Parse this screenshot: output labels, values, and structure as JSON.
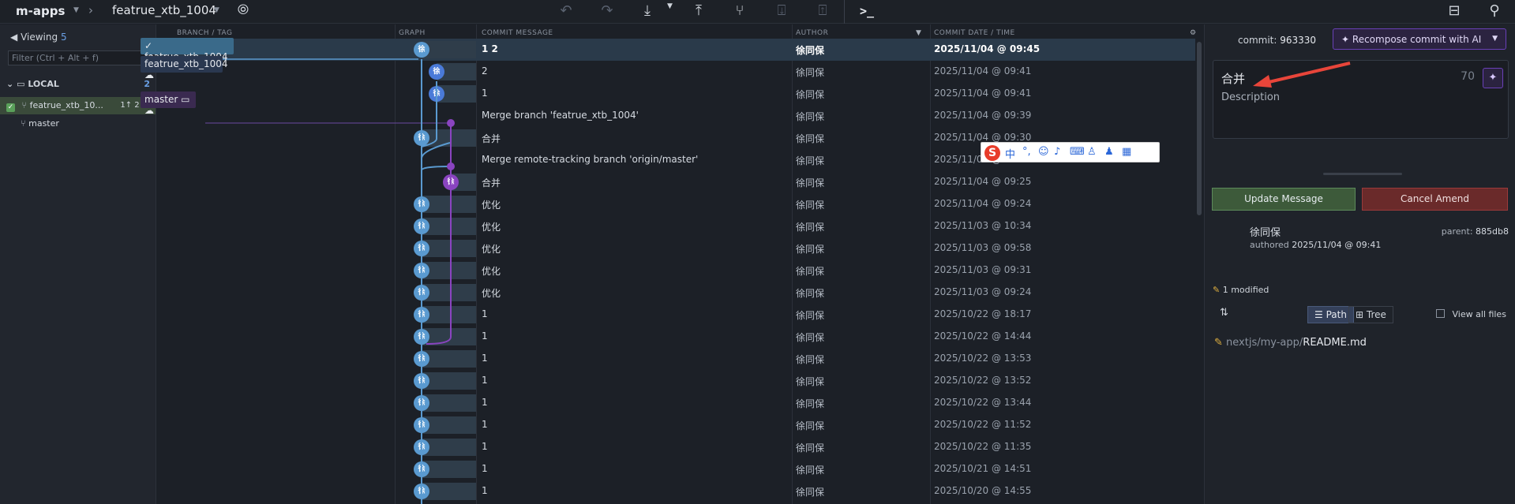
{
  "topbar": {
    "repo": "m-apps",
    "branch": "featrue_xtb_1004",
    "icons": [
      "lightning-icon",
      "undo-icon",
      "redo-icon",
      "pull-icon",
      "push-icon",
      "branch-icon",
      "stash-icon",
      "pop-icon",
      "terminal-icon",
      "layout-icon",
      "search-icon"
    ]
  },
  "left": {
    "viewing_label": "Viewing",
    "viewing_count": "5",
    "filter_placeholder": "Filter (Ctrl + Alt + f)",
    "local_label": "LOCAL",
    "local_count": "2",
    "branches": [
      {
        "name": "featrue_xtb_10...",
        "ahead_behind": "1↑ 2↓",
        "active": true
      },
      {
        "name": "master",
        "active": false
      }
    ]
  },
  "columns": {
    "branch": "BRANCH / TAG",
    "graph": "GRAPH",
    "message": "COMMIT MESSAGE",
    "author": "AUTHOR",
    "date": "COMMIT DATE / TIME"
  },
  "branch_labels": {
    "current": "featrue_xtb_1004",
    "remote": "featrue_xtb_1004",
    "master": "master"
  },
  "commits": [
    {
      "message": "1  2",
      "author": "徐同保",
      "date": "2025/11/04 @ 09:45",
      "avatar": "徐"
    },
    {
      "message": "2",
      "author": "徐同保",
      "date": "2025/11/04 @ 09:41",
      "avatar": "徐"
    },
    {
      "message": "1",
      "author": "徐同保",
      "date": "2025/11/04 @ 09:41",
      "avatar": "徐"
    },
    {
      "message": "Merge branch 'featrue_xtb_1004'",
      "author": "徐同保",
      "date": "2025/11/04 @ 09:39",
      "avatar": ""
    },
    {
      "message": "合并",
      "author": "徐同保",
      "date": "2025/11/04 @ 09:30",
      "avatar": "徐"
    },
    {
      "message": "Merge remote-tracking branch 'origin/master'",
      "author": "徐同保",
      "date": "2025/11/04 @ 09:25",
      "avatar": ""
    },
    {
      "message": "合并",
      "author": "徐同保",
      "date": "2025/11/04 @ 09:25",
      "avatar": "徐"
    },
    {
      "message": "优化",
      "author": "徐同保",
      "date": "2025/11/04 @ 09:24",
      "avatar": "徐"
    },
    {
      "message": "优化",
      "author": "徐同保",
      "date": "2025/11/03 @ 10:34",
      "avatar": "徐"
    },
    {
      "message": "优化",
      "author": "徐同保",
      "date": "2025/11/03 @ 09:58",
      "avatar": "徐"
    },
    {
      "message": "优化",
      "author": "徐同保",
      "date": "2025/11/03 @ 09:31",
      "avatar": "徐"
    },
    {
      "message": "优化",
      "author": "徐同保",
      "date": "2025/11/03 @ 09:24",
      "avatar": "徐"
    },
    {
      "message": "1",
      "author": "徐同保",
      "date": "2025/10/22 @ 18:17",
      "avatar": "徐"
    },
    {
      "message": "1",
      "author": "徐同保",
      "date": "2025/10/22 @ 14:44",
      "avatar": "徐"
    },
    {
      "message": "1",
      "author": "徐同保",
      "date": "2025/10/22 @ 13:53",
      "avatar": "徐"
    },
    {
      "message": "1",
      "author": "徐同保",
      "date": "2025/10/22 @ 13:52",
      "avatar": "徐"
    },
    {
      "message": "1",
      "author": "徐同保",
      "date": "2025/10/22 @ 13:44",
      "avatar": "徐"
    },
    {
      "message": "1",
      "author": "徐同保",
      "date": "2025/10/22 @ 11:52",
      "avatar": "徐"
    },
    {
      "message": "1",
      "author": "徐同保",
      "date": "2025/10/22 @ 11:35",
      "avatar": "徐"
    },
    {
      "message": "1",
      "author": "徐同保",
      "date": "2025/10/21 @ 14:51",
      "avatar": "徐"
    },
    {
      "message": "1",
      "author": "徐同保",
      "date": "2025/10/20 @ 14:55",
      "avatar": "徐"
    }
  ],
  "right": {
    "commit_label": "commit:",
    "commit_sha": "963330",
    "recompose": "Recompose commit with AI",
    "summary": "合并",
    "char_count": "70",
    "description_placeholder": "Description",
    "update_button": "Update Message",
    "cancel_button": "Cancel Amend",
    "author_name": "徐同保",
    "authored_label": "authored",
    "authored_date": "2025/11/04 @ 09:41",
    "parent_label": "parent:",
    "parent_sha": "885db8",
    "modified": "1 modified",
    "path_tab": "Path",
    "tree_tab": "Tree",
    "view_all": "View all files",
    "file_dir": "nextjs/my-app/",
    "file_name": "README.md"
  },
  "ime": {
    "lang": "中"
  },
  "colors": {
    "graph_blue": "#5a9ad0",
    "graph_purple": "#8a44c0",
    "update_green": "#3d5a3a",
    "cancel_red": "#6a2a2a",
    "ai_purple": "#6a40b8"
  }
}
